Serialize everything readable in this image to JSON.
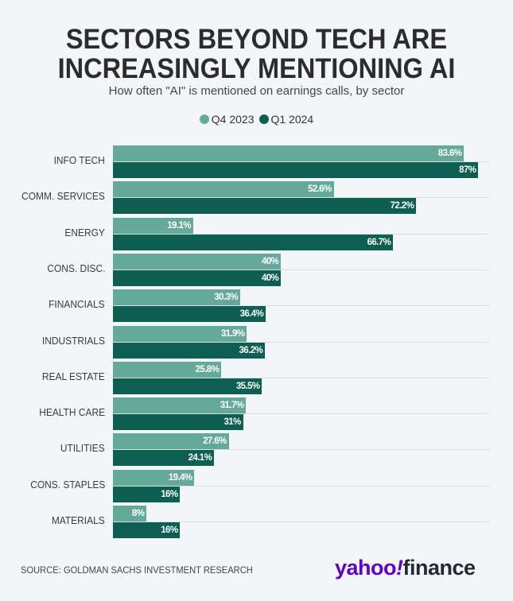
{
  "colors": {
    "q4_2023": "#64a999",
    "q1_2024": "#0c5f51",
    "yahoo_purple": "#6001d2",
    "finance_dark": "#232a31"
  },
  "logo": {
    "yahoo": "yahoo",
    "bang": "!",
    "finance": "finance"
  },
  "source": "SOURCE: GOLDMAN SACHS INVESTMENT RESEARCH",
  "chart_data": {
    "type": "bar",
    "orientation": "horizontal",
    "title_lines": [
      "SECTORS BEYOND TECH ARE",
      "INCREASINGLY MENTIONING AI"
    ],
    "title": "SECTORS BEYOND TECH ARE INCREASINGLY MENTIONING AI",
    "subtitle": "How often \"AI\" is mentioned on earnings calls, by sector",
    "xlabel": "",
    "ylabel": "",
    "xlim": [
      0,
      100
    ],
    "grid": true,
    "legend_position": "top-center",
    "categories": [
      "INFO TECH",
      "COMM. SERVICES",
      "ENERGY",
      "CONS. DISC.",
      "FINANCIALS",
      "INDUSTRIALS",
      "REAL ESTATE",
      "HEALTH CARE",
      "UTILITIES",
      "CONS. STAPLES",
      "MATERIALS"
    ],
    "series": [
      {
        "name": "Q4 2023",
        "values": [
          83.6,
          52.6,
          19.1,
          40,
          30.3,
          31.9,
          25.8,
          31.7,
          27.6,
          19.4,
          8
        ],
        "labels": [
          "83.6%",
          "52.6%",
          "19.1%",
          "40%",
          "30.3%",
          "31.9%",
          "25.8%",
          "31.7%",
          "27.6%",
          "19.4%",
          "8%"
        ]
      },
      {
        "name": "Q1 2024",
        "values": [
          87,
          72.2,
          66.7,
          40,
          36.4,
          36.2,
          35.5,
          31,
          24.1,
          16,
          16
        ],
        "labels": [
          "87%",
          "72.2%",
          "66.7%",
          "40%",
          "36.4%",
          "36.2%",
          "35.5%",
          "31%",
          "24.1%",
          "16%",
          "16%"
        ]
      }
    ]
  }
}
